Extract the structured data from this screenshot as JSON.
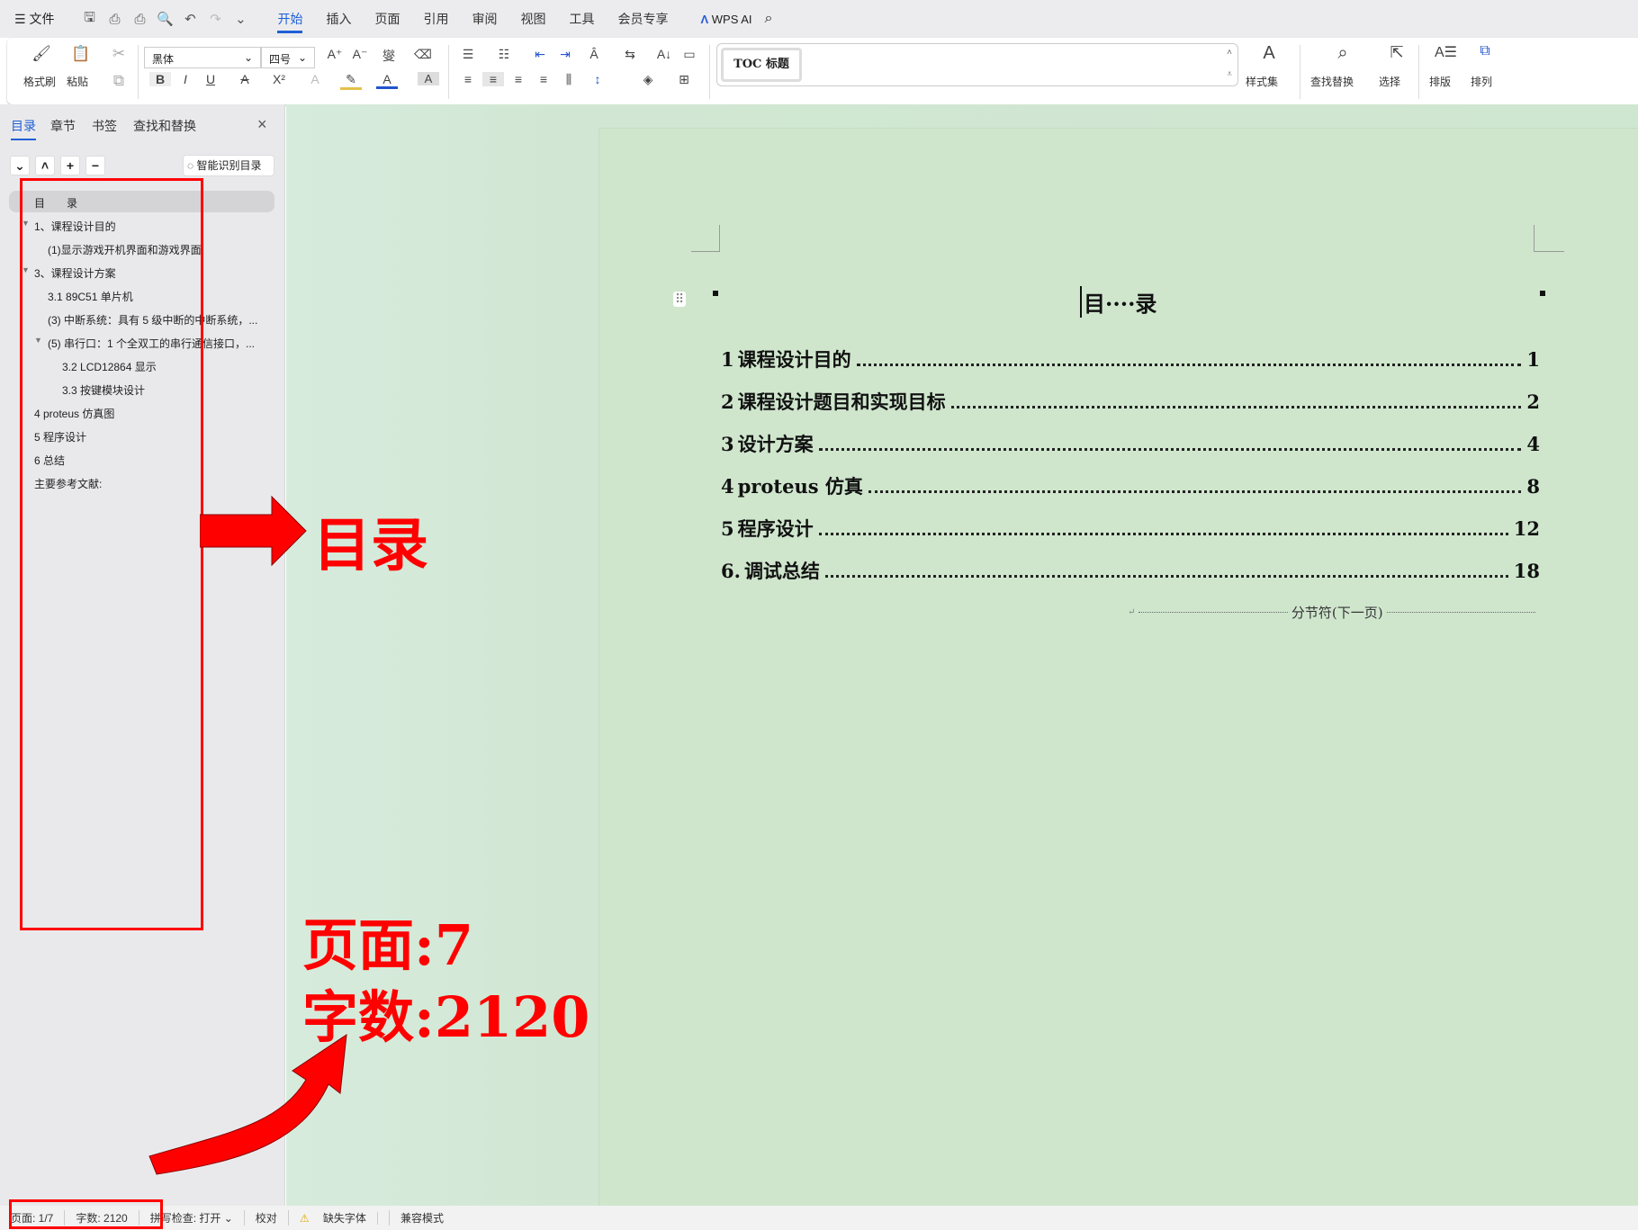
{
  "menubar": {
    "file": "文件",
    "tabs": [
      "开始",
      "插入",
      "页面",
      "引用",
      "审阅",
      "视图",
      "工具",
      "会员专享"
    ],
    "active_tab": "开始",
    "wps_ai": "WPS AI"
  },
  "ribbon": {
    "format_painter": "格式刷",
    "paste": "粘贴",
    "font": "黑体",
    "size": "四号",
    "style_preview": "TOC 标题",
    "style_set": "样式集",
    "find_replace": "查找替换",
    "select": "选择",
    "layout": "排版",
    "arrange": "排列",
    "bold": "B",
    "italic": "I",
    "underline": "U"
  },
  "sidebar": {
    "tabs": [
      "目录",
      "章节",
      "书签",
      "查找和替换"
    ],
    "smart_toc": "智能识别目录",
    "items": [
      "目　　录",
      "1、课程设计目的",
      "(1)显示游戏开机界面和游戏界面",
      "3、课程设计方案",
      "3.1 89C51 单片机",
      "(3) 中断系统：具有 5 级中断的中断系统，...",
      "(5) 串行口：1 个全双工的串行通信接口，...",
      "3.2 LCD12864 显示",
      "3.3  按键模块设计",
      "4 proteus 仿真图",
      "5  程序设计",
      "6    总结",
      "主要参考文献:"
    ]
  },
  "document": {
    "title": "目····录",
    "toc": [
      {
        "num": "1",
        "title": "课程设计目的",
        "page": "1"
      },
      {
        "num": "2",
        "title": "课程设计题目和实现目标",
        "page": "2"
      },
      {
        "num": "3",
        "title": "设计方案",
        "page": "4"
      },
      {
        "num": "4",
        "title": "proteus 仿真",
        "page": "8"
      },
      {
        "num": "5",
        "title": "程序设计",
        "page": "12"
      },
      {
        "num": "6.",
        "title": "调试总结",
        "page": "18"
      }
    ],
    "section_break": "分节符(下一页)"
  },
  "annotations": {
    "toc_label": "目录",
    "pages_label": "页面:7",
    "words_label": "字数:2120"
  },
  "status": {
    "page": "页面: 1/7",
    "words": "字数: 2120",
    "spell": "拼写检查: 打开 ⌄",
    "proof": "校对",
    "missing_font": "缺失字体",
    "compat": "兼容模式"
  },
  "colors": {
    "accent": "#1f5fd6",
    "annotation": "#ff0000",
    "page_bg": "#cfe6cd"
  }
}
